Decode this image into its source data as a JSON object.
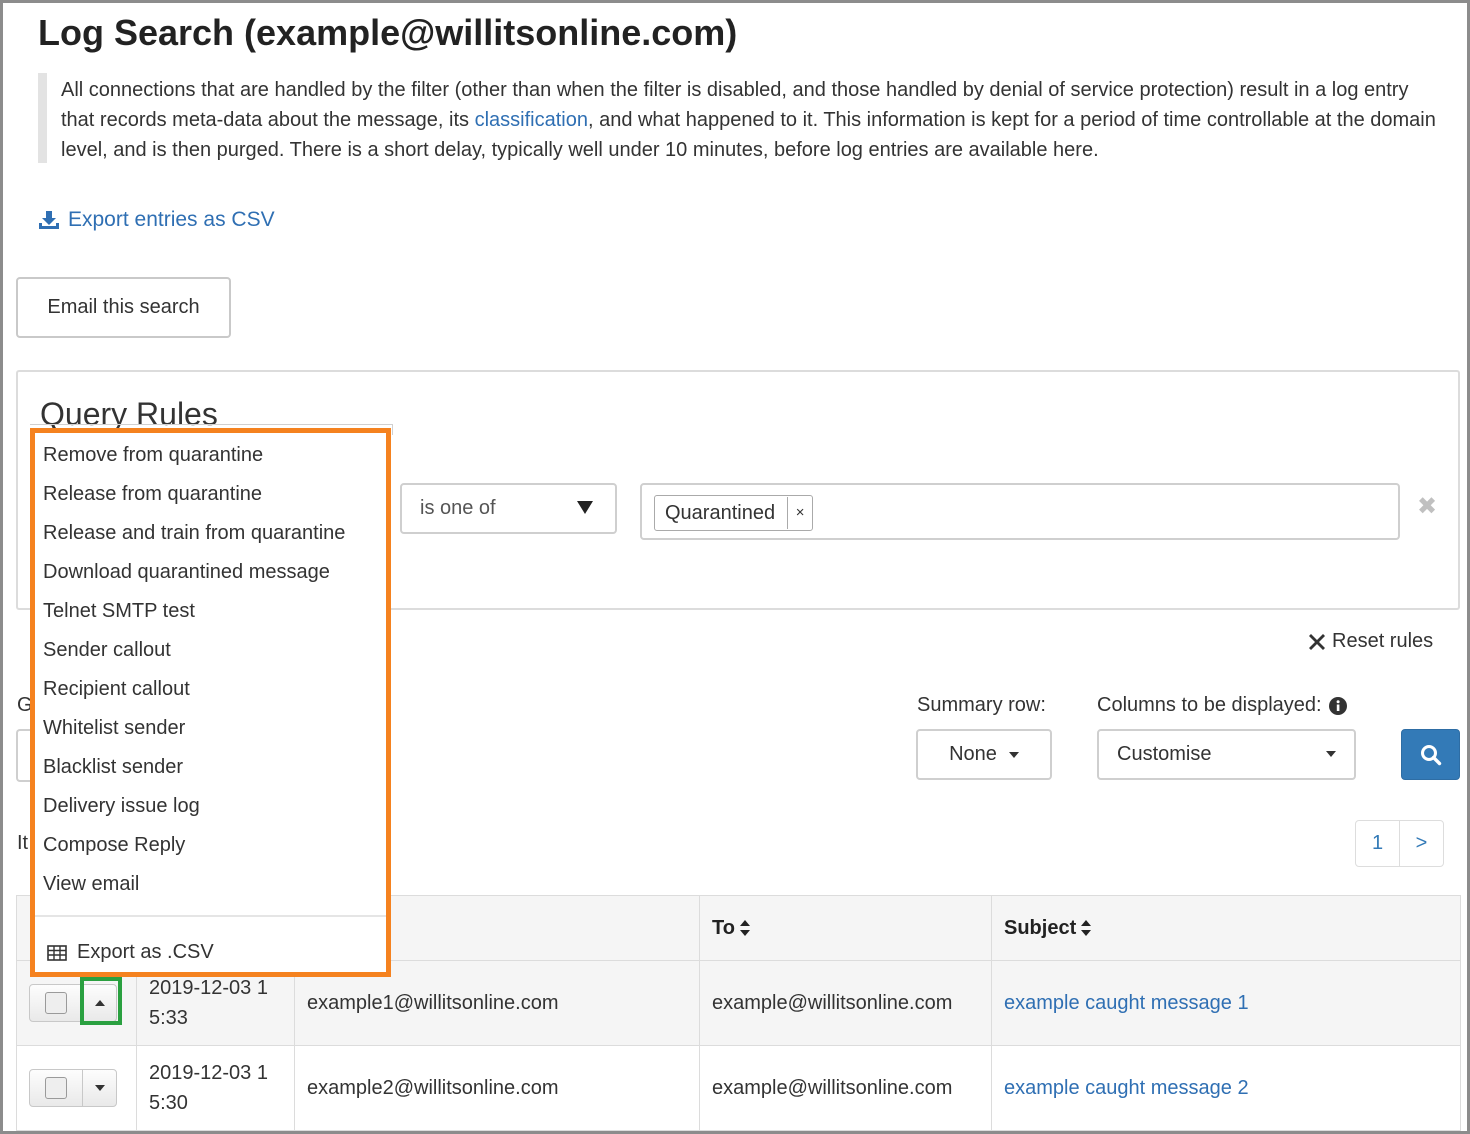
{
  "header": {
    "title": "Log Search (example@willitsonline.com)",
    "intro_before": "All connections that are handled by the filter (other than when the filter is disabled, and those handled by denial of service protection) result in a log entry that records meta-data about the message, its ",
    "intro_link": "classification",
    "intro_after": ", and what happened to it. This information is kept for a period of time controllable at the domain level, and is then purged. There is a short delay, typically well under 10 minutes, before log entries are available here."
  },
  "export_csv_link": "Export entries as CSV",
  "email_search_button": "Email this search",
  "query_rules": {
    "title": "Query Rules",
    "operator": "is one of",
    "tag": "Quarantined",
    "tag_remove": "×",
    "rule_remove": "✖",
    "reset": "Reset rules"
  },
  "controls": {
    "fragment_g": "G",
    "fragment_it": "It",
    "summary_label": "Summary row:",
    "summary_value": "None",
    "columns_label": "Columns to be displayed:",
    "columns_value": "Customise"
  },
  "pagination": {
    "current": "1",
    "next": ">"
  },
  "table": {
    "headers": {
      "to": "To",
      "subject": "Subject"
    },
    "rows": [
      {
        "date": "2019-12-03 1",
        "time": "5:33",
        "from": "example1@willitsonline.com",
        "to": "example@willitsonline.com",
        "subject": "example caught message 1"
      },
      {
        "date": "2019-12-03 1",
        "time": "5:30",
        "from": "example2@willitsonline.com",
        "to": "example@willitsonline.com",
        "subject": "example caught message 2"
      }
    ]
  },
  "dropdown_menu": {
    "items": [
      "Remove from quarantine",
      "Release from quarantine",
      "Release and train from quarantine",
      "Download quarantined message",
      "Telnet SMTP test",
      "Sender callout",
      "Recipient callout",
      "Whitelist sender",
      "Blacklist sender",
      "Delivery issue log",
      "Compose Reply",
      "View email"
    ],
    "export": "Export as .CSV"
  },
  "colors": {
    "link": "#2f6fb3",
    "primary": "#337ab7",
    "menu_highlight": "#f5821f",
    "toggle_highlight": "#2aa040"
  }
}
